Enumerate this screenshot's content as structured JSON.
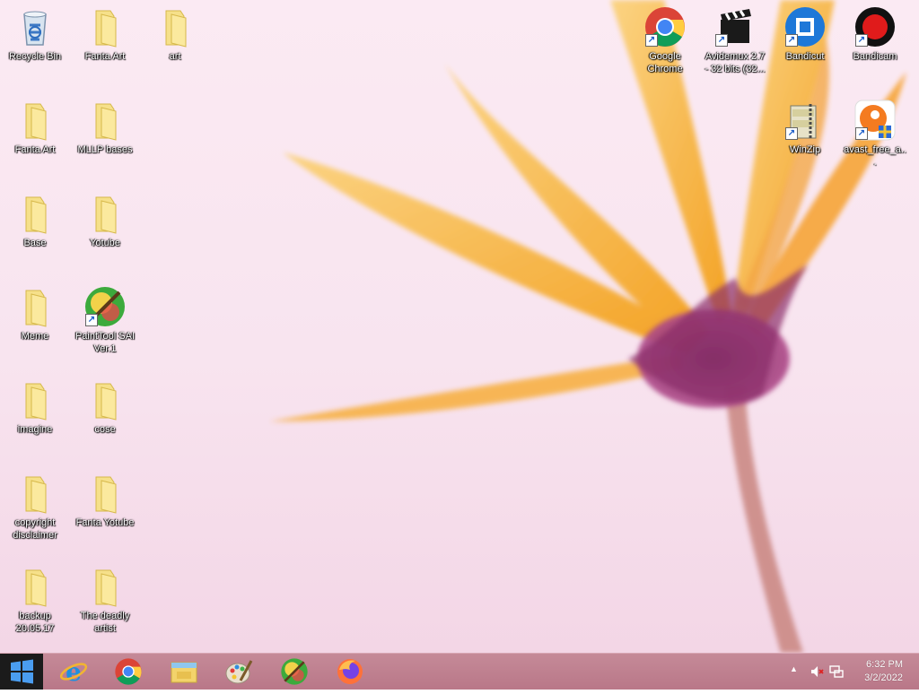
{
  "desktop": {
    "icons": [
      {
        "label": "Recycle Bin",
        "icon": "recycle-bin-icon"
      },
      {
        "label": "Fanta Art",
        "icon": "folder-icon"
      },
      {
        "label": "art",
        "icon": "folder-icon"
      },
      {
        "label": "Fanta Art",
        "icon": "folder-icon"
      },
      {
        "label": "MLLP bases",
        "icon": "folder-icon"
      },
      {
        "label": "Base",
        "icon": "folder-icon"
      },
      {
        "label": "Yotube",
        "icon": "folder-icon"
      },
      {
        "label": "Meme",
        "icon": "folder-icon"
      },
      {
        "label": "PaintTool SAI Ver.1",
        "icon": "painttool-sai-icon"
      },
      {
        "label": "imagine",
        "icon": "folder-icon"
      },
      {
        "label": "cose",
        "icon": "folder-icon"
      },
      {
        "label": "copyright disclaimer",
        "icon": "folder-icon"
      },
      {
        "label": "Fanta Yotube",
        "icon": "folder-icon"
      },
      {
        "label": "backup 20.05.17",
        "icon": "folder-icon"
      },
      {
        "label": "The deadly artist",
        "icon": "folder-icon"
      },
      {
        "label": "Google Chrome",
        "icon": "chrome-icon"
      },
      {
        "label": "Avidemux 2.7 - 32 bits (32...",
        "icon": "avidemux-icon"
      },
      {
        "label": "Bandicut",
        "icon": "bandicut-icon"
      },
      {
        "label": "Bandicam",
        "icon": "bandicam-icon"
      },
      {
        "label": "WinZip",
        "icon": "winzip-icon"
      },
      {
        "label": "avast_free_a...",
        "icon": "avast-icon"
      }
    ]
  },
  "taskbar": {
    "start": "windows-start-icon",
    "pinned": [
      "internet-explorer-icon",
      "chrome-icon",
      "file-explorer-icon",
      "paint-icon",
      "painttool-sai-icon",
      "firefox-icon"
    ],
    "tray": {
      "time": "6:32 PM",
      "date": "3/2/2022",
      "show_hidden": "▲"
    }
  },
  "colors": {
    "taskbar": "#b97788",
    "petal": "#f5a623",
    "flower_center": "#8c2f6b"
  }
}
